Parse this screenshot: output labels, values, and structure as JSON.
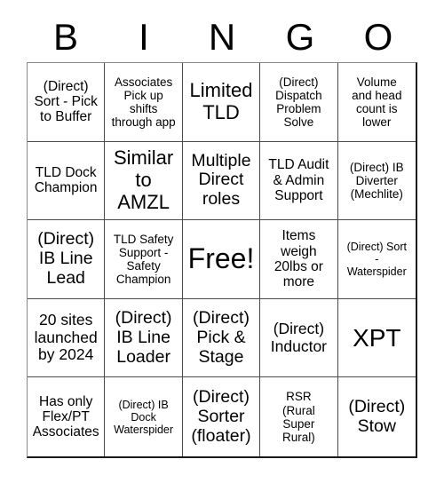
{
  "card": {
    "title": "BINGO",
    "header_letters": [
      "B",
      "I",
      "N",
      "G",
      "O"
    ],
    "colors": {
      "text": "#000000",
      "grid_line": "#4a4a4a",
      "outer_border": "#1a1a1a",
      "background": "#ffffff"
    },
    "rows": 5,
    "columns": 5,
    "free_space_index": 12,
    "cells": [
      {
        "text": "(Direct)\nSort - Pick\nto Buffer",
        "size": "fs-15"
      },
      {
        "text": "Associates\nPick up\nshifts\nthrough app",
        "size": "fs-13"
      },
      {
        "text": "Limited\nTLD",
        "size": "fs-22"
      },
      {
        "text": "(Direct)\nDispatch\nProblem\nSolve",
        "size": "fs-13"
      },
      {
        "text": "Volume\nand head\ncount is\nlower",
        "size": "fs-13"
      },
      {
        "text": "TLD Dock\nChampion",
        "size": "fs-15"
      },
      {
        "text": "Similar\nto\nAMZL",
        "size": "fs-22"
      },
      {
        "text": "Multiple\nDirect\nroles",
        "size": "fs-19"
      },
      {
        "text": "TLD Audit\n& Admin\nSupport",
        "size": "fs-15"
      },
      {
        "text": "(Direct) IB\nDiverter\n(Mechlite)",
        "size": "fs-13"
      },
      {
        "text": "(Direct)\nIB Line\nLead",
        "size": "fs-19"
      },
      {
        "text": "TLD Safety\nSupport -\nSafety\nChampion",
        "size": "fs-13"
      },
      {
        "text": "Free!",
        "size": "fs-32"
      },
      {
        "text": "Items\nweigh\n20lbs or\nmore",
        "size": "fs-15"
      },
      {
        "text": "(Direct) Sort\n-\nWaterspider",
        "size": "fs-12"
      },
      {
        "text": "20 sites\nlaunched\nby 2024",
        "size": "fs-17"
      },
      {
        "text": "(Direct)\nIB Line\nLoader",
        "size": "fs-19"
      },
      {
        "text": "(Direct)\nPick &\nStage",
        "size": "fs-19"
      },
      {
        "text": "(Direct)\nInductor",
        "size": "fs-17"
      },
      {
        "text": "XPT",
        "size": "fs-28"
      },
      {
        "text": "Has only\nFlex/PT\nAssociates",
        "size": "fs-15"
      },
      {
        "text": "(Direct) IB\nDock\nWaterspider",
        "size": "fs-12"
      },
      {
        "text": "(Direct)\nSorter\n(floater)",
        "size": "fs-19"
      },
      {
        "text": "RSR\n(Rural\nSuper\nRural)",
        "size": "fs-13"
      },
      {
        "text": "(Direct)\nStow",
        "size": "fs-19"
      }
    ]
  }
}
